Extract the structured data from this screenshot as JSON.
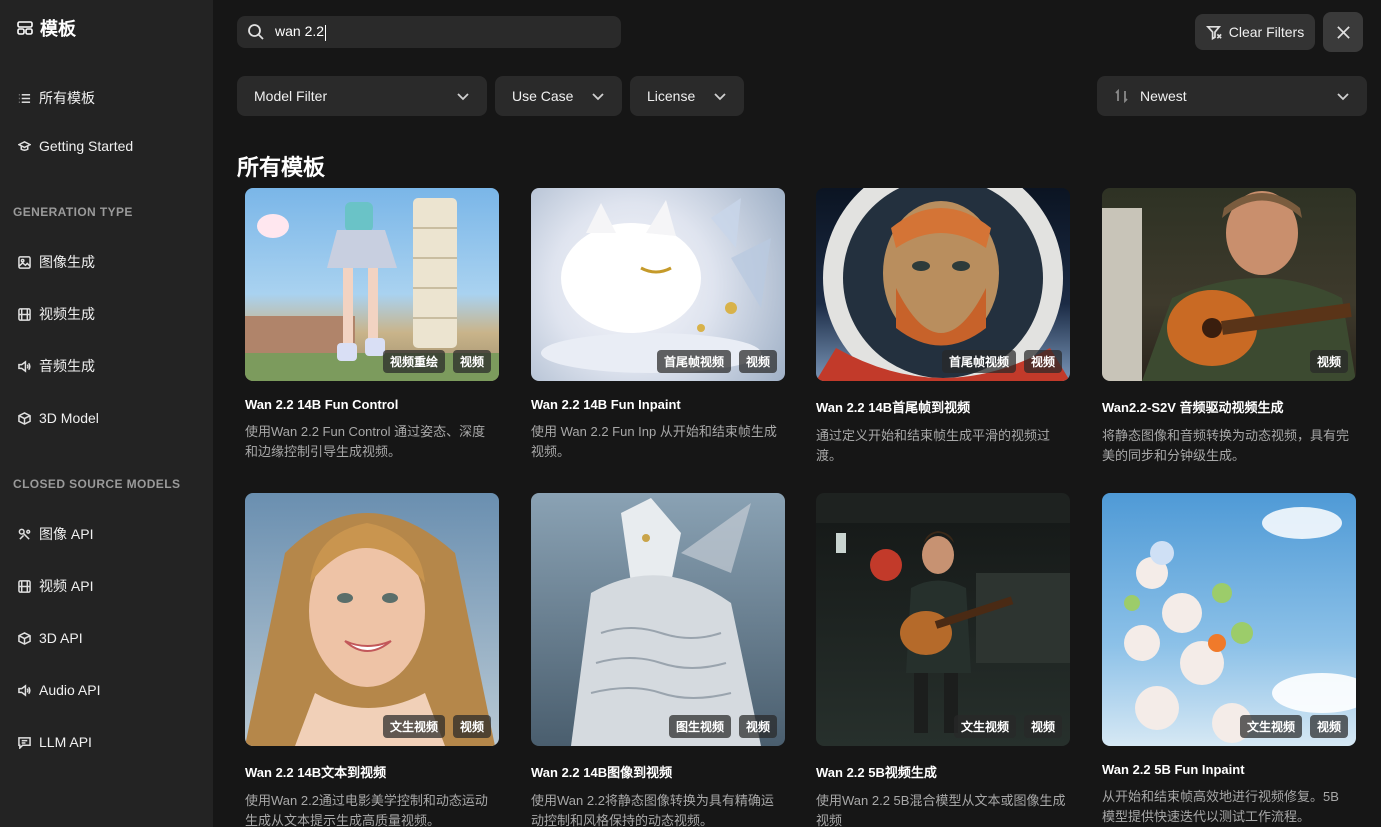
{
  "sidebar": {
    "brand": "模板",
    "items": [
      {
        "label": "所有模板"
      },
      {
        "label": "Getting Started"
      }
    ],
    "generation_header": "GENERATION TYPE",
    "generation_items": [
      {
        "label": "图像生成"
      },
      {
        "label": "视频生成"
      },
      {
        "label": "音频生成"
      },
      {
        "label": "3D Model"
      }
    ],
    "closed_header": "CLOSED SOURCE MODELS",
    "closed_items": [
      {
        "label": "图像 API"
      },
      {
        "label": "视频 API"
      },
      {
        "label": "3D API"
      },
      {
        "label": "Audio API"
      },
      {
        "label": "LLM API"
      }
    ]
  },
  "search": {
    "value": "wan 2.2"
  },
  "toolbar": {
    "clear_filters": "Clear Filters"
  },
  "filters": {
    "model": "Model Filter",
    "use_case": "Use Case",
    "license": "License",
    "sort": "Newest"
  },
  "page_title": "所有模板",
  "cards": [
    {
      "title": "Wan 2.2 14B Fun Control",
      "desc": "使用Wan 2.2 Fun Control 通过姿态、深度和边缘控制引导生成视频。",
      "tags": [
        "视频重绘",
        "视频"
      ]
    },
    {
      "title": "Wan 2.2 14B Fun Inpaint",
      "desc": "使用 Wan 2.2 Fun Inp 从开始和结束帧生成视频。",
      "tags": [
        "首尾帧视频",
        "视频"
      ]
    },
    {
      "title": "Wan 2.2 14B首尾帧到视频",
      "desc": "通过定义开始和结束帧生成平滑的视频过渡。",
      "tags": [
        "首尾帧视频",
        "视频"
      ]
    },
    {
      "title": "Wan2.2-S2V 音频驱动视频生成",
      "desc": "将静态图像和音频转换为动态视频，具有完美的同步和分钟级生成。",
      "tags": [
        "视频"
      ]
    },
    {
      "title": "Wan 2.2 14B文本到视频",
      "desc": "使用Wan 2.2通过电影美学控制和动态运动生成从文本提示生成高质量视频。",
      "tags": [
        "文生视频",
        "视频"
      ]
    },
    {
      "title": "Wan 2.2 14B图像到视频",
      "desc": "使用Wan 2.2将静态图像转换为具有精确运动控制和风格保持的动态视频。",
      "tags": [
        "图生视频",
        "视频"
      ]
    },
    {
      "title": "Wan 2.2 5B视频生成",
      "desc": "使用Wan 2.2 5B混合模型从文本或图像生成视频",
      "tags": [
        "文生视频",
        "视频"
      ]
    },
    {
      "title": "Wan 2.2 5B Fun Inpaint",
      "desc": "从开始和结束帧高效地进行视频修复。5B 模型提供快速迭代以测试工作流程。",
      "tags": [
        "文生视频",
        "视频"
      ]
    }
  ]
}
